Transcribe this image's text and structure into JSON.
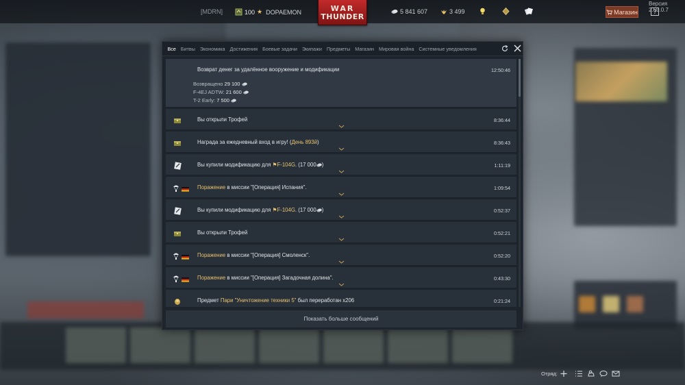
{
  "topbar": {
    "squad_tag": "[MDRN]",
    "level": "100",
    "nickname": "DOPAEMON",
    "silver": "5 841 607",
    "gold": "3 499",
    "shop_label": "Магазин",
    "help_label": "?",
    "version": "Версия 2.59.0.7"
  },
  "logo": {
    "line1": "WAR",
    "line2": "THUNDER"
  },
  "tabs": [
    "Все",
    "Битвы",
    "Экономика",
    "Достижения",
    "Боевые задачи",
    "Экипажи",
    "Предметы",
    "Магазин",
    "Мировая война",
    "Системные уведомления"
  ],
  "messages": {
    "m0": {
      "title": "Возврат денег за удалённое вооружение и модификации",
      "time": "12:50:46",
      "returned_label": "Возвращено",
      "returned_value": "29 100",
      "item1_label": "F-4EJ ADTW:",
      "item1_value": "21 600",
      "item2_label": "T-2 Early:",
      "item2_value": "7 500"
    },
    "m1": {
      "text": "Вы открыли Трофей",
      "time": "8:36:44"
    },
    "m2": {
      "prefix": "Награда за ежедневный вход в игру! (",
      "highlight": "День 893й",
      "suffix": ")",
      "time": "8:36:43"
    },
    "m3": {
      "prefix": "Вы купили модификацию для ",
      "highlight": "⚑F-104G",
      "suffix": ". (17 000",
      "suffix2": ")",
      "time": "1:11:19"
    },
    "m4": {
      "highlight": "Поражение",
      "suffix": " в миссии \"[Операция] Испания\".",
      "time": "1:09:54"
    },
    "m5": {
      "prefix": "Вы купили модификацию для ",
      "highlight": "⚑F-104G",
      "suffix": ". (17 000",
      "suffix2": ")",
      "time": "0:52:37"
    },
    "m6": {
      "text": "Вы открыли Трофей",
      "time": "0:52:21"
    },
    "m7": {
      "highlight": "Поражение",
      "suffix": " в миссии \"[Операция] Смоленск\".",
      "time": "0:52:20"
    },
    "m8": {
      "highlight": "Поражение",
      "suffix": " в миссии \"[Операция] Загадочная долина\".",
      "time": "0:43:30"
    },
    "m9": {
      "prefix": "Предмет ",
      "highlight": "Пари \"Уничтожение техники 5\"",
      "suffix": " был переработан x206",
      "time": "0:21:24"
    }
  },
  "show_more": "Показать больше сообщений",
  "bottombar": {
    "squad_label": "Отряд:"
  },
  "colors": {
    "accent": "#e8c271",
    "window_bg": "#1d242c",
    "row_bg": "#283039",
    "shop_bg": "#7a3a26",
    "logo_red": "#c22a2a"
  }
}
